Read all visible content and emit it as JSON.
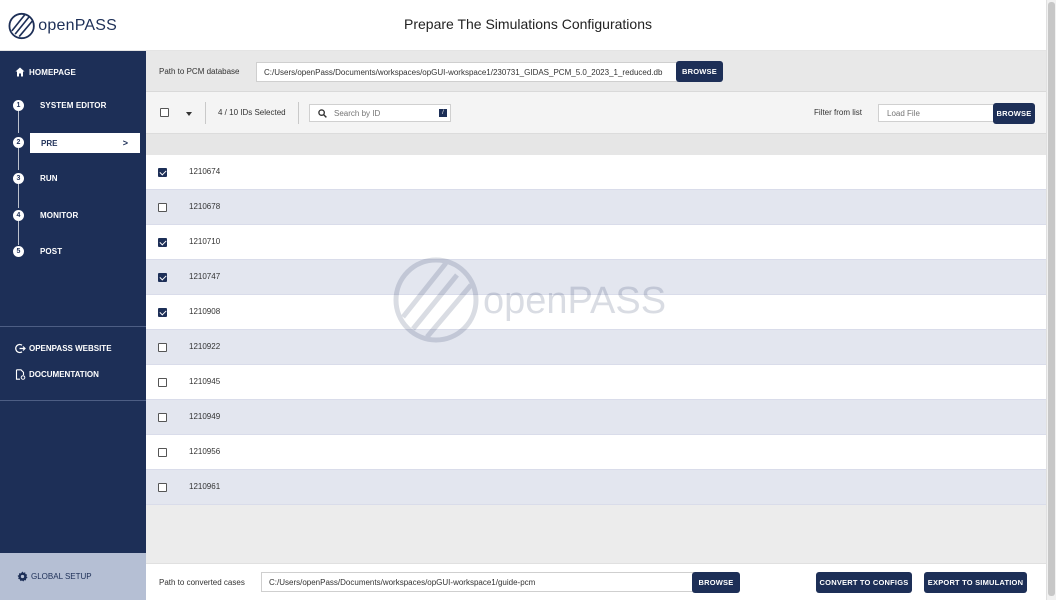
{
  "app": {
    "logo_text": "openPASS",
    "page_title": "Prepare The Simulations Configurations"
  },
  "sidebar": {
    "home_label": "HOMEPAGE",
    "steps": [
      {
        "number": "1",
        "label": "SYSTEM EDITOR"
      },
      {
        "number": "2",
        "label": "PRE",
        "active": true,
        "chevron": ">"
      },
      {
        "number": "3",
        "label": "RUN"
      },
      {
        "number": "4",
        "label": "MONITOR"
      },
      {
        "number": "5",
        "label": "POST"
      }
    ],
    "links": [
      {
        "label": "OPENPASS WEBSITE",
        "icon": "external-link-icon"
      },
      {
        "label": "DOCUMENTATION",
        "icon": "document-icon"
      }
    ],
    "global_setup_label": "GLOBAL SETUP"
  },
  "pcm": {
    "label": "Path to PCM database",
    "path": "C:/Users/openPass/Documents/workspaces/opGUI-workspace1/230731_GIDAS_PCM_5.0_2023_1_reduced.db",
    "browse_label": "BROWSE"
  },
  "filter": {
    "selected_text": "4 / 10 IDs Selected",
    "search_placeholder": "Search by ID",
    "search_shortcut": "/",
    "filter_label": "Filter from list",
    "load_placeholder": "Load File",
    "browse_label": "BROWSE"
  },
  "cases": [
    {
      "id": "1210674",
      "checked": true
    },
    {
      "id": "1210678",
      "checked": false
    },
    {
      "id": "1210710",
      "checked": true
    },
    {
      "id": "1210747",
      "checked": true
    },
    {
      "id": "1210908",
      "checked": true
    },
    {
      "id": "1210922",
      "checked": false
    },
    {
      "id": "1210945",
      "checked": false
    },
    {
      "id": "1210949",
      "checked": false
    },
    {
      "id": "1210956",
      "checked": false
    },
    {
      "id": "1210961",
      "checked": false
    }
  ],
  "bottom": {
    "label": "Path to converted cases",
    "path": "C:/Users/openPass/Documents/workspaces/opGUI-workspace1/guide-pcm",
    "browse_label": "BROWSE",
    "convert_label": "CONVERT TO CONFIGS",
    "export_label": "EXPORT TO SIMULATION"
  },
  "colors": {
    "navy": "#1d2f57",
    "row_alt": "#e3e6ef",
    "global_setup_bg": "#b5bfd4"
  }
}
